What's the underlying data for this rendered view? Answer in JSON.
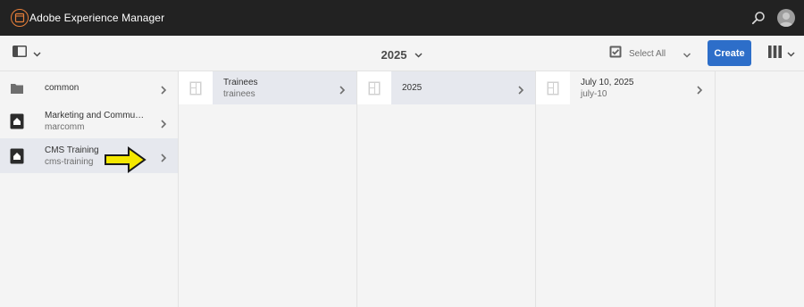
{
  "header": {
    "app_title": "Adobe Experience Manager",
    "colors": {
      "bar": "#222222",
      "logo_ring": "#e87f3a",
      "accent": "#2d6ec9"
    }
  },
  "toolbar": {
    "folder_title": "2025",
    "select_all_label": "Select All",
    "create_label": "Create"
  },
  "columns": [
    {
      "items": [
        {
          "title": "common",
          "subtitle": "",
          "icon": "folder-icon",
          "selected": false
        },
        {
          "title": "Marketing and Commu…",
          "subtitle": "marcomm",
          "icon": "site-icon",
          "selected": false
        },
        {
          "title": "CMS Training",
          "subtitle": "cms-training",
          "icon": "site-icon",
          "selected": true
        }
      ]
    },
    {
      "items": [
        {
          "title": "Trainees",
          "subtitle": "trainees",
          "icon": "page-icon",
          "selected": true
        }
      ]
    },
    {
      "items": [
        {
          "title": "2025",
          "subtitle": "",
          "icon": "page-icon",
          "selected": true
        }
      ]
    },
    {
      "items": [
        {
          "title": "July 10, 2025",
          "subtitle": "july-10",
          "icon": "page-icon",
          "selected": false
        }
      ]
    }
  ],
  "annotation": {
    "icon": "yellow-arrow-icon",
    "color": "#f5e800"
  }
}
